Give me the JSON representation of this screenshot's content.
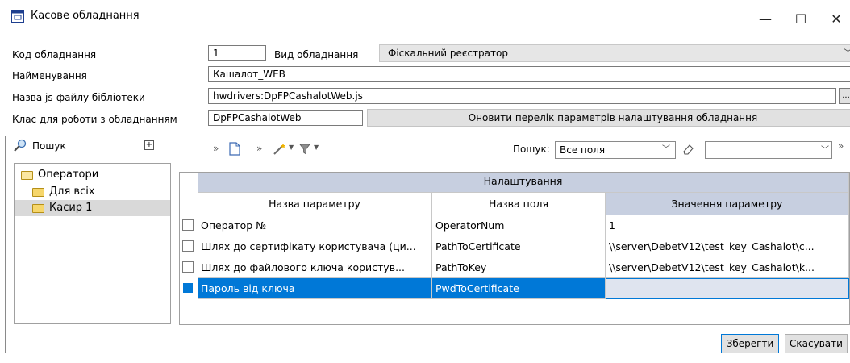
{
  "window": {
    "title": "Касове обладнання",
    "minimize": "—",
    "maximize": "☐",
    "close": "✕"
  },
  "form": {
    "code_label": "Код обладнання",
    "code_value": "1",
    "type_label": "Вид обладнання",
    "type_value": "Фіскальний реєстратор",
    "name_label": "Найменування",
    "name_value": "Кашалот_WEB",
    "js_label": "Назва js-файлу бібліотеки",
    "js_value": "hwdrivers:DpFPCashalotWeb.js",
    "js_browse": "...",
    "class_label": "Клас для роботи з обладнанням",
    "class_value": "DpFPCashalotWeb",
    "refresh_button": "Оновити перелік параметрів налаштування обладнання"
  },
  "left_panel": {
    "search_label": "Пошук",
    "tree": [
      {
        "label": "Оператори",
        "level": 0
      },
      {
        "label": "Для всіх",
        "level": 1
      },
      {
        "label": "Касир 1",
        "level": 1
      }
    ]
  },
  "toolbar": {
    "search_label": "Пошук:",
    "search_scope": "Все поля",
    "search_value": ""
  },
  "grid": {
    "group_header": "Налаштування",
    "columns": [
      "Назва параметру",
      "Назва поля",
      "Значення параметру"
    ],
    "rows": [
      {
        "param": "Оператор №",
        "field": "OperatorNum",
        "value": "1"
      },
      {
        "param": "Шлях до сертифікату користувача (ци...",
        "field": "PathToCertificate",
        "value": "\\\\server\\DebetV12\\test_key_Cashalot\\c..."
      },
      {
        "param": "Шлях до файлового ключа користув...",
        "field": "PathToKey",
        "value": "\\\\server\\DebetV12\\test_key_Cashalot\\k..."
      },
      {
        "param": "Пароль від ключа",
        "field": "PwdToCertificate",
        "value": ""
      }
    ]
  },
  "colors": {
    "selection": "#0078d7",
    "column_header_active": "#c7cfe0",
    "group_header": "#c7cfe0"
  },
  "buttons": {
    "save": "Зберегти",
    "cancel": "Скасувати"
  }
}
